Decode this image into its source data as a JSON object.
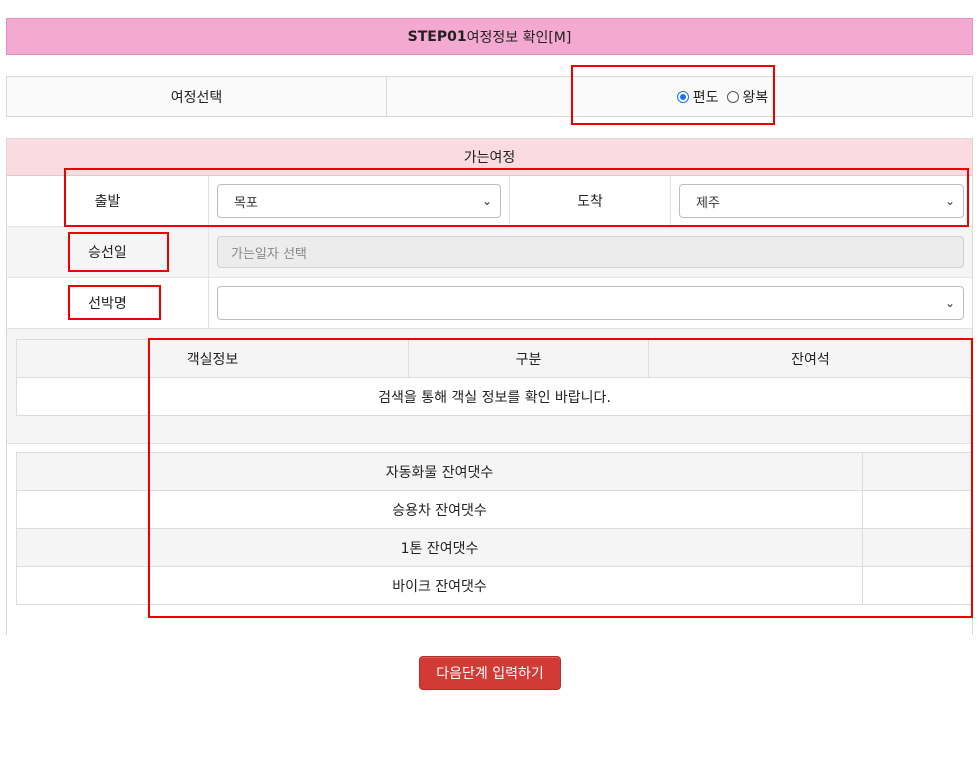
{
  "header": {
    "step": "STEP01",
    "title": "여정정보 확인[M]"
  },
  "trip_type": {
    "label": "여정선택",
    "options": [
      {
        "label": "편도",
        "checked": true
      },
      {
        "label": "왕복",
        "checked": false
      }
    ]
  },
  "journey": {
    "title": "가는여정",
    "depart_label": "출발",
    "depart_value": "목포",
    "arrive_label": "도착",
    "arrive_value": "제주",
    "date_label": "승선일",
    "date_placeholder": "가는일자 선택",
    "ship_label": "선박명",
    "ship_value": ""
  },
  "room_table": {
    "headers": [
      "객실정보",
      "구분",
      "잔여석"
    ],
    "empty_message": "검색을 통해 객실 정보를 확인 바랍니다."
  },
  "vehicles": [
    {
      "label": "자동화물 잔여댓수",
      "value": ""
    },
    {
      "label": "승용차 잔여댓수",
      "value": ""
    },
    {
      "label": "1톤 잔여댓수",
      "value": ""
    },
    {
      "label": "바이크 잔여댓수",
      "value": ""
    }
  ],
  "next_button": "다음단계 입력하기",
  "colors": {
    "header_bg": "#f4a9d1",
    "journey_head_bg": "#f9dbe1",
    "button_bg": "#d23a36",
    "highlight": "#ee0000",
    "radio_accent": "#1a73e8"
  }
}
